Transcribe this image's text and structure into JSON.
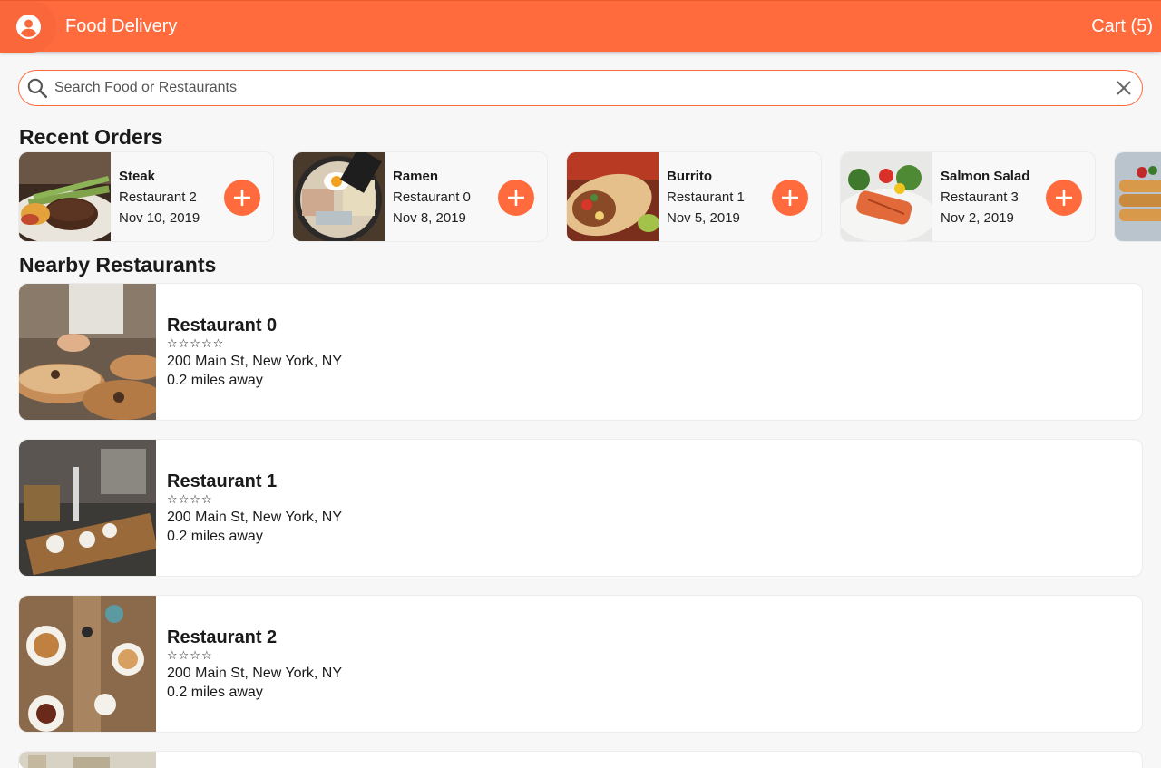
{
  "header": {
    "title": "Food Delivery",
    "cart_label": "Cart (5)",
    "account_icon": "account-circle-icon",
    "accent_color": "#ff6b3d"
  },
  "search": {
    "placeholder": "Search Food or Restaurants",
    "value": "",
    "search_icon": "search-icon",
    "clear_icon": "close-icon"
  },
  "recent": {
    "title": "Recent Orders",
    "orders": [
      {
        "name": "Steak",
        "restaurant": "Restaurant 2",
        "date": "Nov 10, 2019"
      },
      {
        "name": "Ramen",
        "restaurant": "Restaurant 0",
        "date": "Nov 8, 2019"
      },
      {
        "name": "Burrito",
        "restaurant": "Restaurant 1",
        "date": "Nov 5, 2019"
      },
      {
        "name": "Salmon Salad",
        "restaurant": "Restaurant 3",
        "date": "Nov 2, 2019"
      }
    ]
  },
  "nearby": {
    "title": "Nearby Restaurants",
    "restaurants": [
      {
        "name": "Restaurant 0",
        "stars": "☆☆☆☆☆",
        "address": "200 Main St, New York, NY",
        "distance": "0.2 miles away"
      },
      {
        "name": "Restaurant 1",
        "stars": "☆☆☆☆",
        "address": "200 Main St, New York, NY",
        "distance": "0.2 miles away"
      },
      {
        "name": "Restaurant 2",
        "stars": "☆☆☆☆",
        "address": "200 Main St, New York, NY",
        "distance": "0.2 miles away"
      }
    ]
  }
}
